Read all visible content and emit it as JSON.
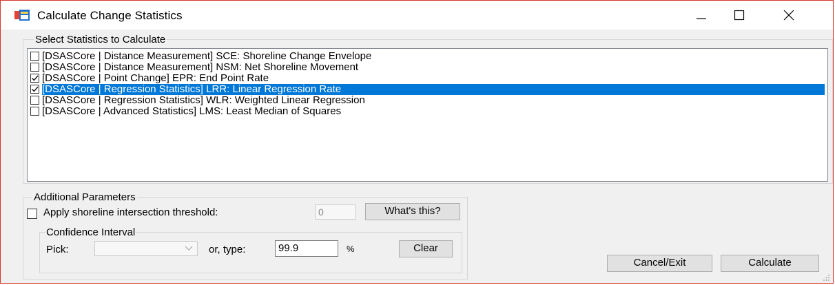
{
  "window": {
    "title": "Calculate Change Statistics",
    "accent_color": "#d9342b",
    "selection_color": "#0078d7",
    "icons": {
      "app": "app-icon",
      "minimize": "minimize-icon",
      "maximize": "maximize-icon",
      "close": "close-icon"
    }
  },
  "statistics": {
    "group_label": "Select Statistics to Calculate",
    "items": [
      {
        "label": "[DSASCore | Distance Measurement] SCE: Shoreline Change Envelope",
        "checked": false,
        "selected": false
      },
      {
        "label": "[DSASCore | Distance Measurement] NSM: Net Shoreline Movement",
        "checked": false,
        "selected": false
      },
      {
        "label": "[DSASCore | Point Change] EPR: End Point Rate",
        "checked": true,
        "selected": false
      },
      {
        "label": "[DSASCore | Regression Statistics] LRR: Linear Regression Rate",
        "checked": true,
        "selected": true
      },
      {
        "label": "[DSASCore | Regression Statistics] WLR: Weighted Linear Regression",
        "checked": false,
        "selected": false
      },
      {
        "label": "[DSASCore | Advanced Statistics] LMS: Least Median of Squares",
        "checked": false,
        "selected": false
      }
    ]
  },
  "additional": {
    "group_label": "Additional Parameters",
    "threshold_label": "Apply shoreline intersection threshold:",
    "threshold_checked": false,
    "threshold_value": "0",
    "whats_this": "What's this?"
  },
  "confidence": {
    "group_label": "Confidence Interval",
    "pick_label": "Pick:",
    "pick_value": "",
    "or_type_label": "or, type:",
    "value": "99.9",
    "percent": "%",
    "clear": "Clear"
  },
  "buttons": {
    "cancel": "Cancel/Exit",
    "calculate": "Calculate"
  }
}
